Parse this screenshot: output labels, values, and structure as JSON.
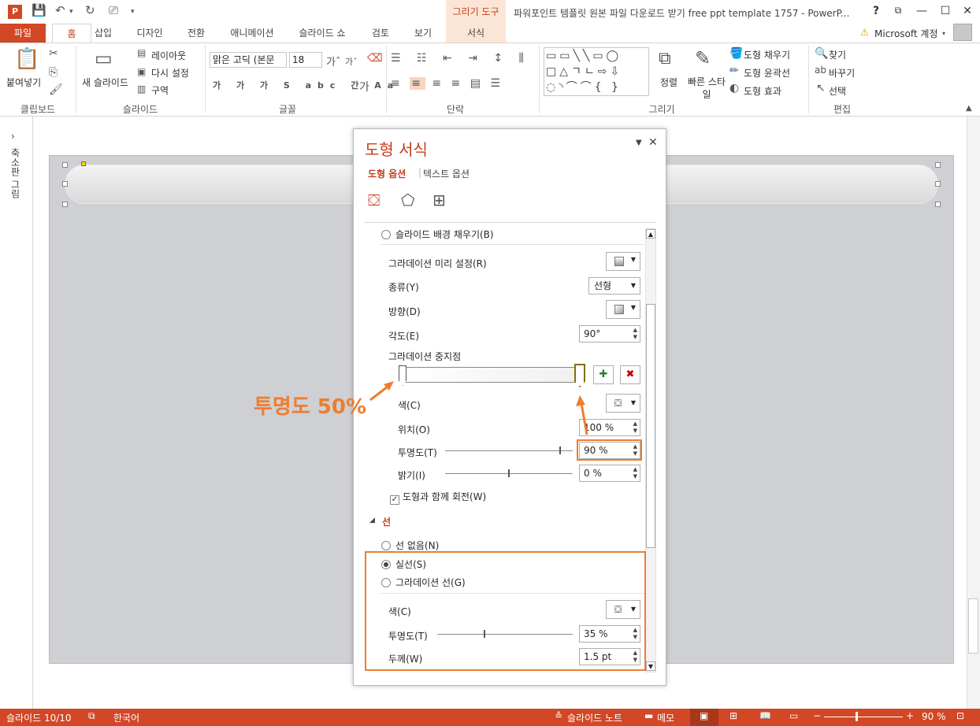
{
  "titlebar": {
    "context_tab": "그리기 도구",
    "window_title": "파워포인트 템플릿 원본 파일 다운로드 받기 free ppt template 1757 - PowerP...",
    "help": "?"
  },
  "tabs": {
    "file": "파일",
    "home": "홈",
    "insert": "삽입",
    "design": "디자인",
    "transitions": "전환",
    "animations": "애니메이션",
    "slideshow": "슬라이드 쇼",
    "review": "검토",
    "view": "보기",
    "format": "서식",
    "account": "Microsoft 계정"
  },
  "ribbon": {
    "paste": "붙여넣기",
    "clipboard_group": "클립보드",
    "new_slide": "새 슬라이드",
    "layout": "레이아웃",
    "reset": "다시 설정",
    "section": "구역",
    "slides_group": "슬라이드",
    "font_name": "맑은 고딕 (본문",
    "font_size": "18",
    "font_group": "글꼴",
    "paragraph_group": "단락",
    "drawing_group": "그리기",
    "arrange": "정렬",
    "quick_styles": "빠른 스타일",
    "shape_fill": "도형 채우기",
    "shape_outline": "도형 윤곽선",
    "shape_effects": "도형 효과",
    "find": "찾기",
    "replace": "바꾸기",
    "select": "선택",
    "editing_group": "편집"
  },
  "thumbnail_pane": {
    "label": "축소판 그림"
  },
  "panel": {
    "title": "도형 서식",
    "tab_shape_options": "도형 옵션",
    "tab_text_options": "텍스트 옵션",
    "slide_bg_fill": "슬라이드 배경 채우기(B)",
    "preset_gradients": "그라데이션 미리 설정(R)",
    "type_label": "종류(Y)",
    "type_value": "선형",
    "direction_label": "방향(D)",
    "angle_label": "각도(E)",
    "angle_value": "90°",
    "gradient_stops": "그라데이션 중지점",
    "stop_color_label": "색(C)",
    "position_label": "위치(O)",
    "position_value": "100 %",
    "transparency_label": "투명도(T)",
    "transparency_value": "90 %",
    "brightness_label": "밝기(I)",
    "brightness_value": "0 %",
    "rotate_with_shape": "도형과 함께 회전(W)",
    "line_section": "선",
    "no_line": "선 없음(N)",
    "solid_line": "실선(S)",
    "gradient_line": "그라데이션 선(G)",
    "line_color_label": "색(C)",
    "line_transparency_label": "투명도(T)",
    "line_transparency_value": "35 %",
    "line_width_label": "두께(W)",
    "line_width_value": "1.5 pt"
  },
  "annotation": {
    "text": "투명도 50%"
  },
  "slider_levels": {
    "transparency": 0.9,
    "brightness": 0.5,
    "line_transparency": 0.35
  },
  "statusbar": {
    "slide_count": "슬라이드 10/10",
    "language": "한국어",
    "notes": "슬라이드 노트",
    "comments": "메모",
    "zoom": "90 %"
  },
  "colors": {
    "accent": "#d24726",
    "annotation": "#ed7d31",
    "panel_title": "#c43e1c"
  }
}
